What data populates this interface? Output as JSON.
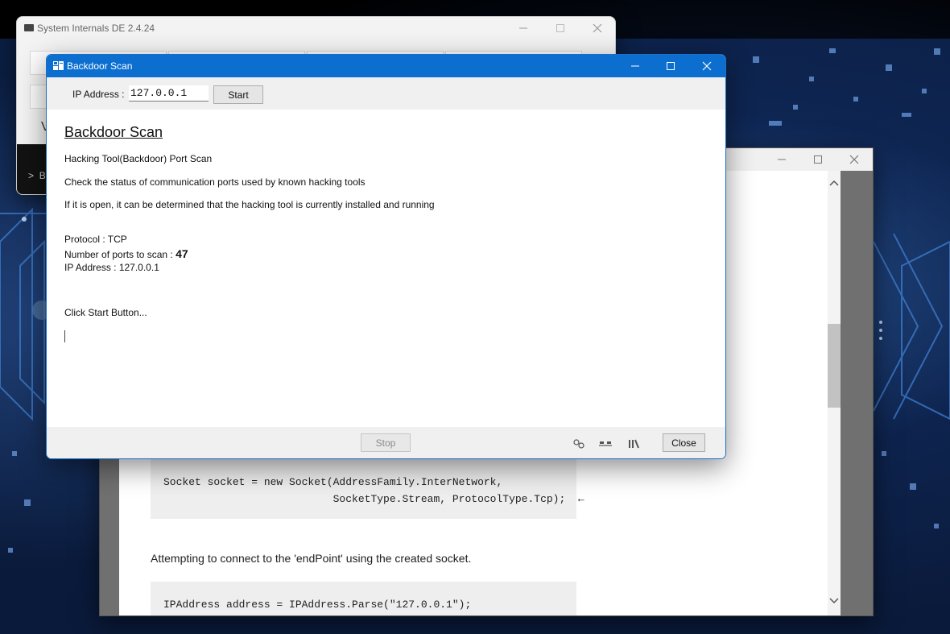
{
  "desktop": {
    "accent": "#0c6fd0"
  },
  "system_internals": {
    "title": "System Internals DE 2.4.24",
    "partial_v": "V",
    "partial_b": "B",
    "chevron": ">"
  },
  "doc_window": {
    "code1_line1": "Socket socket = new Socket(AddressFamily.InterNetwork,",
    "code1_line2": "                           SocketType.Stream, ProtocolType.Tcp);  ←",
    "paragraph": "Attempting to connect to the 'endPoint' using the created socket.",
    "code2_line1": "IPAddress address = IPAddress.Parse(\"127.0.0.1\");"
  },
  "backdoor_scan": {
    "title": "Backdoor Scan",
    "ip_label": "IP Address :",
    "ip_value": "127.0.0.1",
    "start_label": "Start",
    "heading": "Backdoor Scan",
    "line1": "Hacking Tool(Backdoor) Port Scan",
    "line2": "Check the status of communication ports used by known hacking tools",
    "line3": "If it is open, it can be determined that the hacking tool is currently installed and running",
    "protocol": "Protocol : TCP",
    "ports_label": "Number of ports to scan : ",
    "ports_value": "47",
    "ip_line": "IP Address : 127.0.0.1",
    "prompt": "Click Start Button...",
    "stop_label": "Stop",
    "close_label": "Close",
    "icons": [
      "settings-icon",
      "network-icon",
      "library-icon"
    ]
  }
}
